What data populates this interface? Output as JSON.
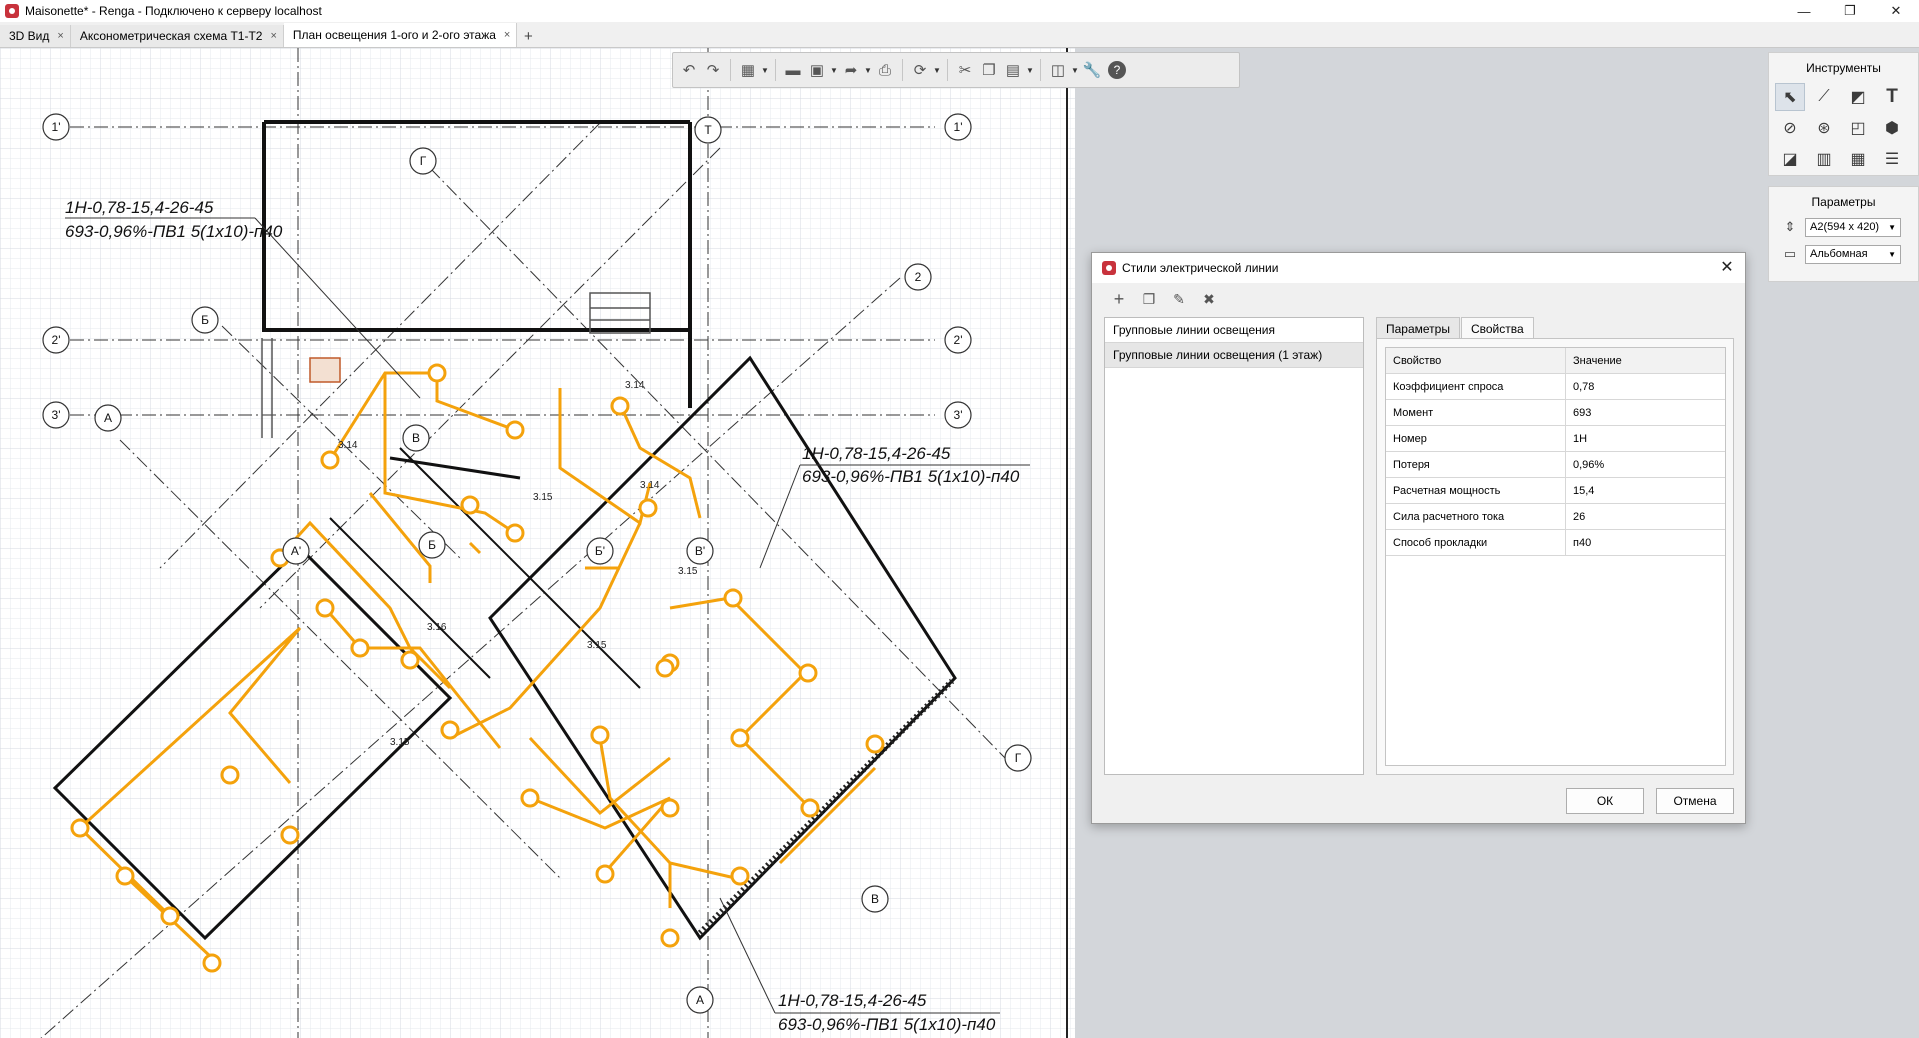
{
  "window": {
    "title": "Maisonette* - Renga - Подключено к серверу localhost",
    "controls": [
      "—",
      "❐",
      "✕"
    ]
  },
  "tabs": [
    {
      "label": "3D Вид",
      "active": false
    },
    {
      "label": "Аксонометрическая схема Т1-Т2",
      "active": false
    },
    {
      "label": "План освещения 1-ого и 2-ого этажа",
      "active": true
    }
  ],
  "tab_add": "+",
  "tab_close": "×",
  "toolbar": {
    "icons": [
      "undo-icon",
      "redo-icon",
      "view-3d-icon",
      "open-folder-icon",
      "save-icon",
      "export-icon",
      "print-icon",
      "sync-icon",
      "cut-icon",
      "copy-icon",
      "paste-icon",
      "layers-icon",
      "wrench-icon",
      "help-icon"
    ]
  },
  "tools_panel": {
    "title": "Инструменты",
    "icons": [
      "select-icon",
      "line-icon",
      "hatch-icon",
      "text-icon",
      "dimension-icon",
      "elevation-icon",
      "view-icon",
      "model-icon",
      "stamp-icon",
      "spec-icon",
      "table-icon",
      "list-icon"
    ]
  },
  "params_panel": {
    "title": "Параметры",
    "format_value": "A2(594 x 420)",
    "orientation_value": "Альбомная"
  },
  "drawing": {
    "axis_labels": {
      "a1": "1'",
      "a1r": "1'",
      "a2": "2'",
      "a2r": "2'",
      "a3": "3'",
      "a3r": "3'",
      "aT": "Т",
      "aG": "Г",
      "aB": "Б",
      "aA": "А",
      "aV": "В",
      "aB2": "Б",
      "a2d": "2",
      "aBp": "Б'",
      "aVp": "В'",
      "aAp": "А'",
      "aGr": "Г",
      "aVb": "В",
      "aAb": "А"
    },
    "annotations": [
      {
        "line1": "1Н-0,78-15,4-26-45",
        "line2": "693-0,96%-ПВ1 5(1х10)-п40"
      },
      {
        "line1": "1Н-0,78-15,4-26-45",
        "line2": "693-0,96%-ПВ1 5(1х10)-п40"
      },
      {
        "line1": "1Н-0,78-15,4-26-45",
        "line2": "693-0,96%-ПВ1 5(1х10)-п40"
      }
    ],
    "small_labels": {
      "s1": "3.14",
      "s2": "3.14",
      "s3": "3.14",
      "s4": "3.15",
      "s5": "3.15",
      "s6": "3.16",
      "s7": "3.15",
      "s8": "3.15"
    },
    "colors": {
      "line": "#f4a20c",
      "wall": "#111111"
    }
  },
  "dialog": {
    "title": "Стили электрической линии",
    "tool_icons": [
      "add-icon",
      "duplicate-icon",
      "edit-icon",
      "delete-icon"
    ],
    "list": [
      {
        "label": "Групповые линии освещения",
        "selected": false
      },
      {
        "label": "Групповые линии освещения (1 этаж)",
        "selected": true
      }
    ],
    "tabs": [
      {
        "label": "Параметры",
        "active": false
      },
      {
        "label": "Свойства",
        "active": true
      }
    ],
    "table": {
      "headers": {
        "property": "Свойство",
        "value": "Значение"
      },
      "rows": [
        {
          "property": "Коэффициент спроса",
          "value": "0,78"
        },
        {
          "property": "Момент",
          "value": "693"
        },
        {
          "property": "Номер",
          "value": "1Н"
        },
        {
          "property": "Потеря",
          "value": "0,96%"
        },
        {
          "property": "Расчетная мощность",
          "value": "15,4"
        },
        {
          "property": "Сила расчетного тока",
          "value": "26"
        },
        {
          "property": "Способ прокладки",
          "value": "п40"
        }
      ]
    },
    "ok": "ОК",
    "cancel": "Отмена",
    "close": "✕"
  }
}
